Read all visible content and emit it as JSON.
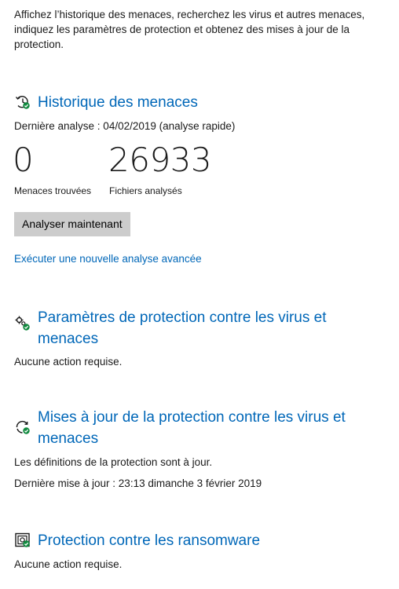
{
  "intro": "Affichez l’historique des menaces, recherchez les virus et autres menaces, indiquez les paramètres de protection et obtenez des mises à jour de la protection.",
  "history": {
    "title": "Historique des menaces",
    "icon": "history-shield-icon",
    "last_scan": "Dernière analyse : 04/02/2019 (analyse rapide)",
    "threats_count": "0",
    "threats_label": "Menaces trouvées",
    "files_count": "26933",
    "files_label": "Fichiers analysés",
    "scan_button": "Analyser maintenant",
    "advanced_link": "Exécuter une nouvelle analyse avancée"
  },
  "settings": {
    "title": "Paramètres de protection contre les virus et menaces",
    "icon": "gears-check-icon",
    "status": "Aucune action requise."
  },
  "updates": {
    "title": "Mises à jour de la protection contre les virus et menaces",
    "icon": "refresh-check-icon",
    "status": "Les définitions de la protection sont à jour.",
    "last_update": "Dernière mise à jour : 23:13 dimanche 3 février 2019"
  },
  "ransomware": {
    "title": "Protection contre les ransomware",
    "icon": "ransomware-shield-icon",
    "status": "Aucune action requise."
  },
  "colors": {
    "accent": "#0067b8",
    "ok_green": "#10893e",
    "button_bg": "#cccccc"
  }
}
